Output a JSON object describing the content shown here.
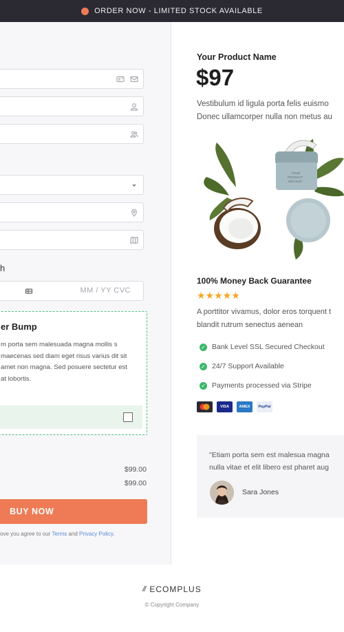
{
  "top_banner": {
    "text": "ORDER NOW - LIMITED STOCK AVAILABLE",
    "accent": "#ee7b56"
  },
  "form": {
    "fields": [
      {
        "name": "email",
        "icon": "id-card-icon",
        "icon2": "envelope-icon",
        "value": ""
      },
      {
        "name": "first-name",
        "icon": "user-icon",
        "value": ""
      },
      {
        "name": "last-name",
        "icon": "users-icon",
        "value": ""
      },
      {
        "name": "country",
        "icon": "chevron-down-icon",
        "value": ""
      },
      {
        "name": "address",
        "icon": "map-pin-icon",
        "value": ""
      },
      {
        "name": "city",
        "icon": "map-icon",
        "value": ""
      }
    ],
    "payment_label": "h",
    "card": {
      "icon": "card-chip-icon",
      "placeholder": "MM / YY  CVC"
    }
  },
  "order_bump": {
    "title": "er Bump",
    "body": "m porta sem malesuada magna mollis s maecenas sed diam eget risus varius dit sit amet non magna. Sed posuere sectetur est at lobortis.",
    "checked": false
  },
  "summary": {
    "line1": "$99.00",
    "line2": "$99.00"
  },
  "buy_button": {
    "label": "BUY NOW",
    "color": "#ee7b56"
  },
  "terms": {
    "prefix": "ove you agree to our ",
    "terms_link": "Terms",
    "and": " and ",
    "privacy_link": "Privacy Policy",
    "suffix": "."
  },
  "product": {
    "name": "Your Product Name",
    "price": "$97",
    "description_line1": "Vestibulum id ligula porta felis euismo",
    "description_line2": "Donec ullamcorper nulla non metus au",
    "mockup_text": "YOUR PRODUCT MOCKUP"
  },
  "guarantee": {
    "title": "100% Money Back Guarantee",
    "rating": 5,
    "stars": "★★★★★",
    "description_line1": "A porttitor vivamus, dolor eros torquent t",
    "description_line2": "blandit rutrum senectus aenean"
  },
  "features": [
    "Bank Level SSL Secured Checkout",
    "24/7 Support Available",
    "Payments processed via Stripe"
  ],
  "payment_methods": [
    {
      "name": "mastercard",
      "label": "",
      "color": "#2b2a33"
    },
    {
      "name": "visa",
      "label": "VISA",
      "color": "#1a2a8a"
    },
    {
      "name": "amex",
      "label": "AMEX",
      "color": "#2b78c5"
    },
    {
      "name": "paypal",
      "label": "PayPal",
      "color": "#e9eef7"
    }
  ],
  "testimonial": {
    "quote_line1": "\"Etiam porta sem est malesua magna",
    "quote_line2": "nulla vitae et elit libero est pharet aug",
    "author": "Sara Jones"
  },
  "footer": {
    "brand": "ECOMPLUS",
    "mark": "//",
    "copyright": "© Copyright Company"
  }
}
